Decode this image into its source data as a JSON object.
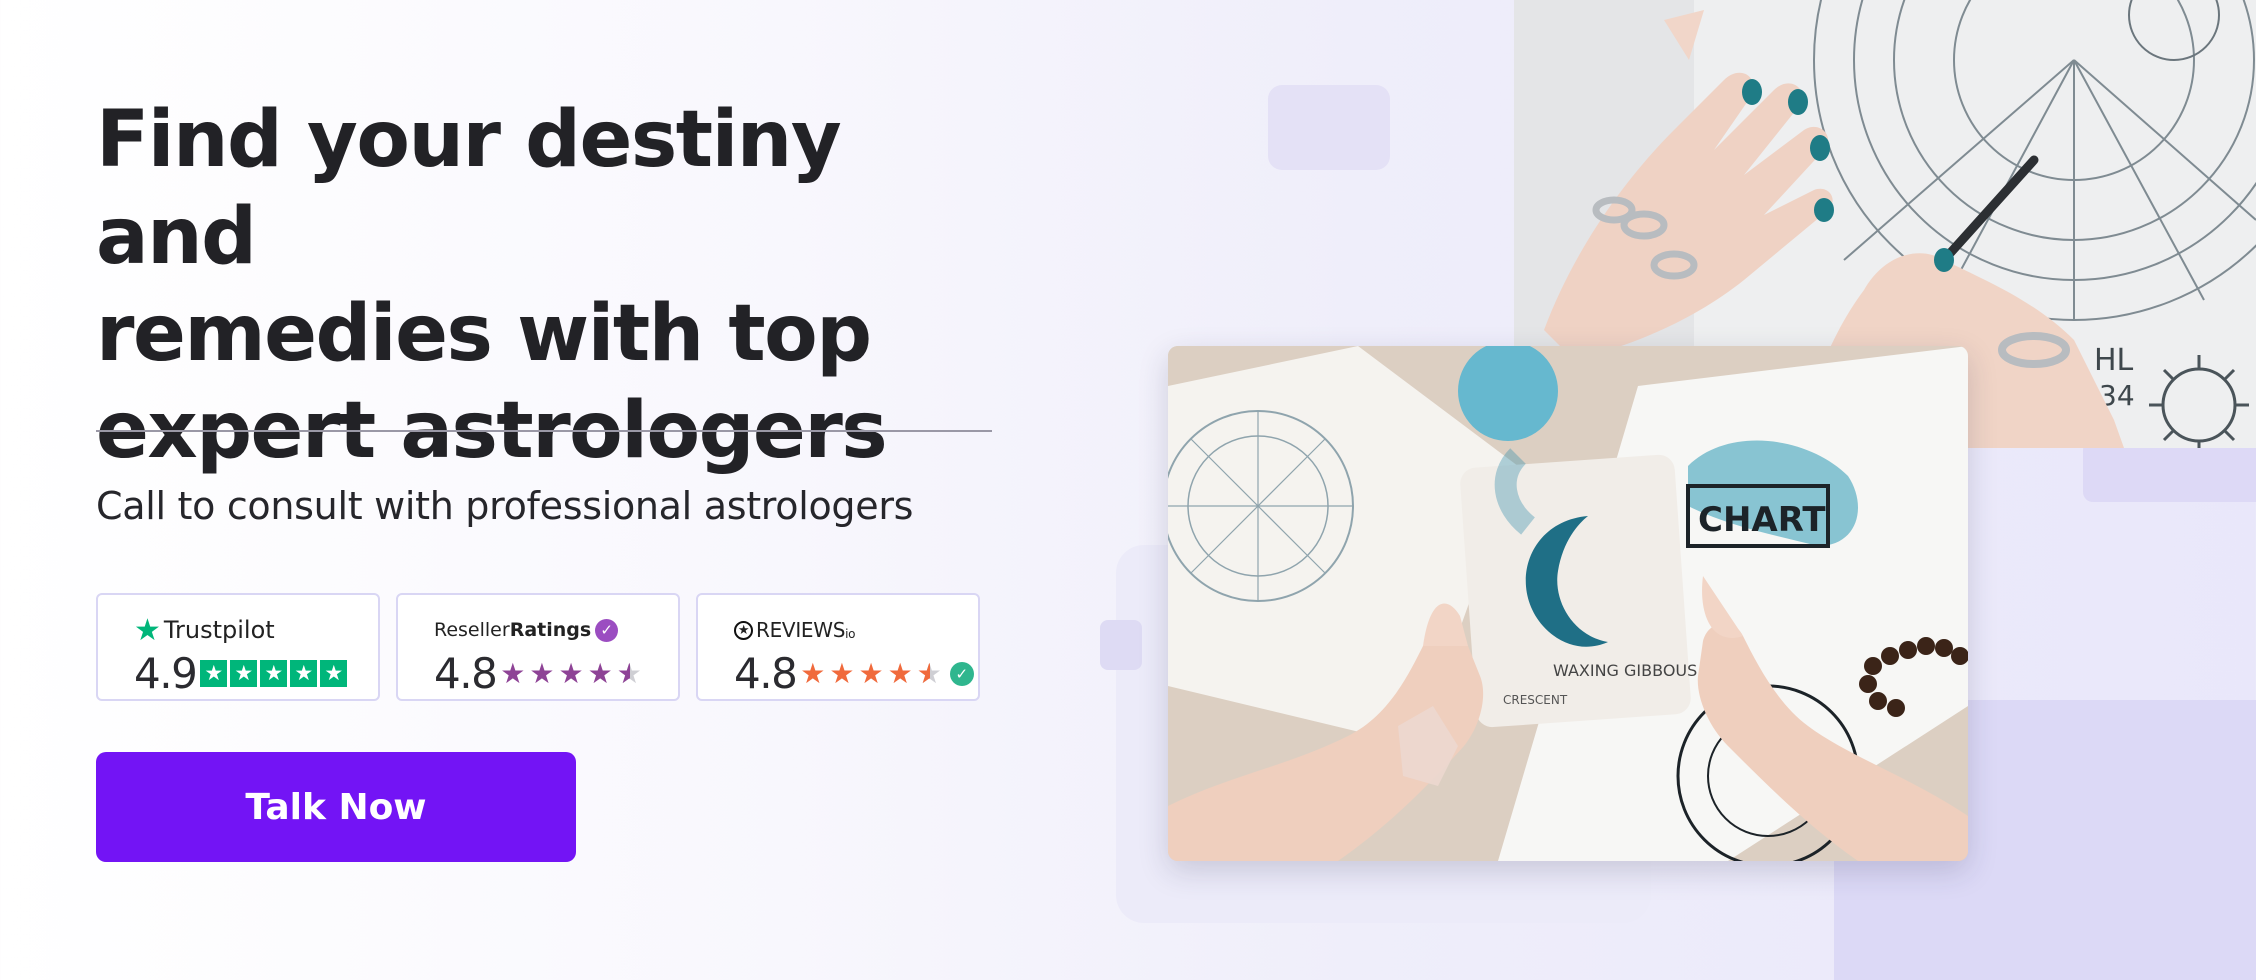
{
  "hero": {
    "headline": [
      "Find your destiny and",
      "remedies with top",
      "expert astrologers"
    ],
    "subtitle": "Call to consult with professional astrologers",
    "cta_label": "Talk Now"
  },
  "ratings": {
    "trustpilot": {
      "brand": "Trustpilot",
      "score": "4.9",
      "stars": 5,
      "color": "#00b67a"
    },
    "resellerratings": {
      "brand_light": "Reseller",
      "brand_bold": "Ratings",
      "score": "4.8",
      "stars": 4.5,
      "color": "#8e4396"
    },
    "reviews_io": {
      "brand": "REVIEWS",
      "brand_suffix": "io",
      "score": "4.8",
      "stars": 4.5,
      "color": "#f06a3c"
    }
  },
  "images": {
    "top_photo": {
      "label_text": [
        "HL",
        "34"
      ],
      "icon": "zodiac-wheel-photo"
    },
    "main_photo": {
      "label_text": [
        "CHART",
        "WAXING GIBBOUS",
        "CRESCENT"
      ],
      "icon": "moon-card-photo"
    }
  },
  "colors": {
    "accent": "#7314f5",
    "badge_border": "#d9d6f4"
  }
}
